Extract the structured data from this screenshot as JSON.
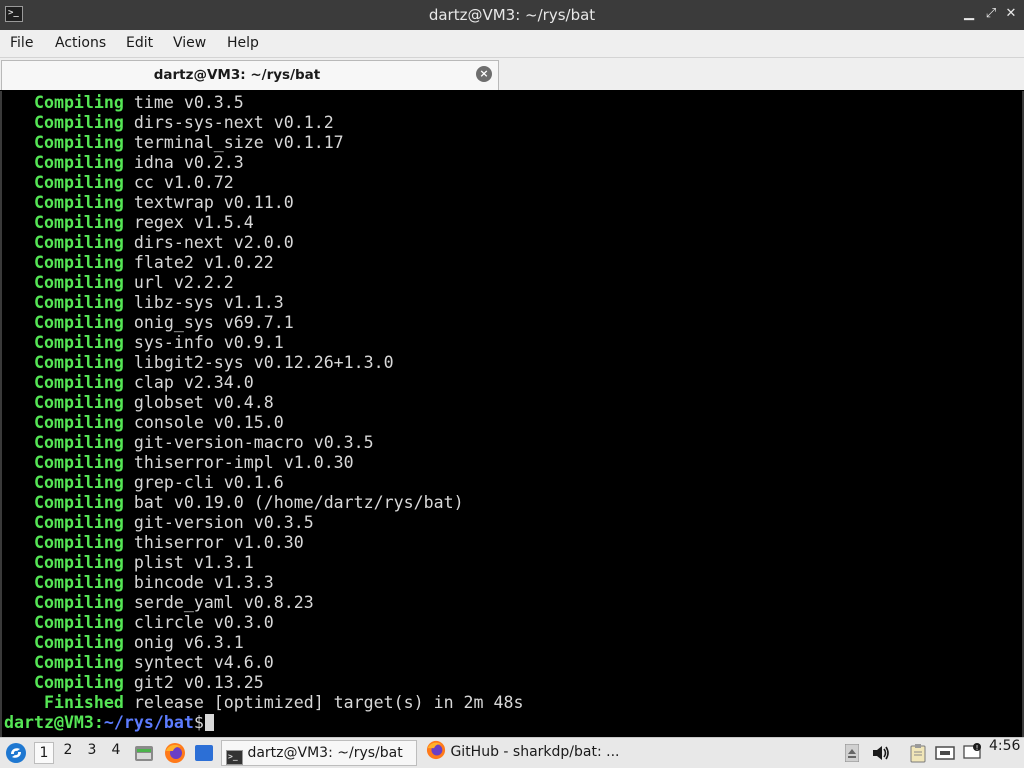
{
  "window": {
    "title": "dartz@VM3: ~/rys/bat",
    "icon": "terminal-icon",
    "controls": [
      "minimize-icon",
      "maximize-icon",
      "close-icon"
    ]
  },
  "menu": {
    "items": [
      "File",
      "Actions",
      "Edit",
      "View",
      "Help"
    ]
  },
  "tab": {
    "label": "dartz@VM3: ~/rys/bat",
    "close_glyph": "×"
  },
  "terminal": {
    "lines": [
      {
        "kw": "   Compiling",
        "rest": " time v0.3.5"
      },
      {
        "kw": "   Compiling",
        "rest": " dirs-sys-next v0.1.2"
      },
      {
        "kw": "   Compiling",
        "rest": " terminal_size v0.1.17"
      },
      {
        "kw": "   Compiling",
        "rest": " idna v0.2.3"
      },
      {
        "kw": "   Compiling",
        "rest": " cc v1.0.72"
      },
      {
        "kw": "   Compiling",
        "rest": " textwrap v0.11.0"
      },
      {
        "kw": "   Compiling",
        "rest": " regex v1.5.4"
      },
      {
        "kw": "   Compiling",
        "rest": " dirs-next v2.0.0"
      },
      {
        "kw": "   Compiling",
        "rest": " flate2 v1.0.22"
      },
      {
        "kw": "   Compiling",
        "rest": " url v2.2.2"
      },
      {
        "kw": "   Compiling",
        "rest": " libz-sys v1.1.3"
      },
      {
        "kw": "   Compiling",
        "rest": " onig_sys v69.7.1"
      },
      {
        "kw": "   Compiling",
        "rest": " sys-info v0.9.1"
      },
      {
        "kw": "   Compiling",
        "rest": " libgit2-sys v0.12.26+1.3.0"
      },
      {
        "kw": "   Compiling",
        "rest": " clap v2.34.0"
      },
      {
        "kw": "   Compiling",
        "rest": " globset v0.4.8"
      },
      {
        "kw": "   Compiling",
        "rest": " console v0.15.0"
      },
      {
        "kw": "   Compiling",
        "rest": " git-version-macro v0.3.5"
      },
      {
        "kw": "   Compiling",
        "rest": " thiserror-impl v1.0.30"
      },
      {
        "kw": "   Compiling",
        "rest": " grep-cli v0.1.6"
      },
      {
        "kw": "   Compiling",
        "rest": " bat v0.19.0 (/home/dartz/rys/bat)"
      },
      {
        "kw": "   Compiling",
        "rest": " git-version v0.3.5"
      },
      {
        "kw": "   Compiling",
        "rest": " thiserror v1.0.30"
      },
      {
        "kw": "   Compiling",
        "rest": " plist v1.3.1"
      },
      {
        "kw": "   Compiling",
        "rest": " bincode v1.3.3"
      },
      {
        "kw": "   Compiling",
        "rest": " serde_yaml v0.8.23"
      },
      {
        "kw": "   Compiling",
        "rest": " clircle v0.3.0"
      },
      {
        "kw": "   Compiling",
        "rest": " onig v6.3.1"
      },
      {
        "kw": "   Compiling",
        "rest": " syntect v4.6.0"
      },
      {
        "kw": "   Compiling",
        "rest": " git2 v0.13.25"
      },
      {
        "kw": "    Finished",
        "rest": " release [optimized] target(s) in 2m 48s"
      }
    ],
    "prompt": {
      "user_host": "dartz@VM3",
      "sep": ":",
      "path": "~/rys/bat",
      "symbol": "$"
    },
    "colors": {
      "keyword": "#55e655",
      "path": "#5c7cff",
      "text": "#d8d8d8",
      "background": "#000000"
    }
  },
  "taskbar": {
    "launcher_icon": "start-menu-icon",
    "workspaces": [
      "1",
      "2",
      "3",
      "4"
    ],
    "active_workspace": "1",
    "quick_launch": [
      "file-manager-icon",
      "firefox-icon",
      "desktop-icon"
    ],
    "tasks": [
      {
        "icon": "terminal-icon",
        "label": "dartz@VM3: ~/rys/bat",
        "active": true
      },
      {
        "icon": "firefox-icon",
        "label": "GitHub - sharkdp/bat: ..."
      }
    ],
    "tray_icons": [
      "eject-icon",
      "volume-icon",
      "clipboard-icon",
      "network-icon",
      "notification-icon"
    ],
    "clock": "4:56"
  }
}
